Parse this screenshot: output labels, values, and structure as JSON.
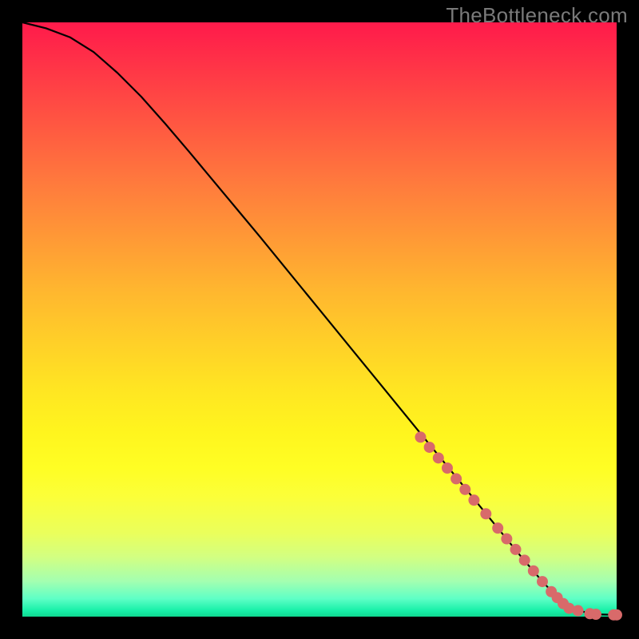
{
  "watermark": "TheBottleneck.com",
  "chart_data": {
    "type": "line",
    "title": "",
    "xlabel": "",
    "ylabel": "",
    "xlim": [
      0,
      100
    ],
    "ylim": [
      0,
      100
    ],
    "grid": false,
    "legend": false,
    "series": [
      {
        "name": "curve",
        "x": [
          0,
          4,
          8,
          12,
          16,
          20,
          24,
          28,
          32,
          36,
          40,
          44,
          48,
          52,
          56,
          60,
          64,
          68,
          72,
          76,
          80,
          84,
          87,
          90,
          93,
          96,
          100
        ],
        "y": [
          100,
          99,
          97.5,
          95,
          91.5,
          87.5,
          83,
          78.3,
          73.5,
          68.7,
          63.9,
          59.0,
          54.1,
          49.2,
          44.3,
          39.4,
          34.5,
          29.6,
          24.7,
          19.8,
          14.9,
          10.0,
          6.5,
          3.2,
          1.2,
          0.4,
          0.3
        ]
      }
    ],
    "markers": {
      "name": "dots",
      "color": "#d86a6a",
      "radius_px": 7,
      "x": [
        67,
        68.5,
        70,
        71.5,
        73,
        74.5,
        76,
        78,
        80,
        81.5,
        83,
        84.5,
        86,
        87.5,
        89,
        90,
        91,
        92,
        93.5,
        95.5,
        96.5,
        99.5,
        100
      ],
      "y": [
        30.2,
        28.5,
        26.7,
        25.0,
        23.2,
        21.4,
        19.6,
        17.3,
        14.9,
        13.1,
        11.3,
        9.5,
        7.7,
        5.9,
        4.2,
        3.2,
        2.2,
        1.4,
        1.0,
        0.5,
        0.4,
        0.3,
        0.3
      ]
    }
  }
}
